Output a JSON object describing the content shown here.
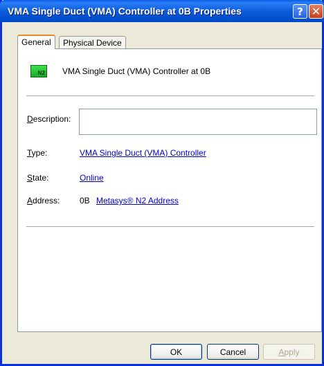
{
  "window": {
    "title": "VMA Single Duct (VMA) Controller at 0B Properties",
    "help_glyph": "?",
    "close_glyph": "✕"
  },
  "tabs": [
    {
      "label": "General",
      "active": true
    },
    {
      "label": "Physical Device",
      "active": false
    }
  ],
  "general": {
    "icon_label": "N2",
    "device_name": "VMA Single Duct (VMA) Controller at 0B",
    "description": {
      "label_access": "D",
      "label_rest": "escription:",
      "value": ""
    },
    "type": {
      "label_access": "T",
      "label_rest": "ype:",
      "value": "VMA Single Duct (VMA) Controller"
    },
    "state": {
      "label_access": "S",
      "label_rest": "tate:",
      "value": "Online"
    },
    "address": {
      "label_access": "A",
      "label_rest": "ddress:",
      "value": "0B",
      "link": "Metasys® N2 Address"
    }
  },
  "buttons": {
    "ok": "OK",
    "cancel": "Cancel",
    "apply_access": "A",
    "apply_rest": "pply"
  },
  "colors": {
    "titlebar": "#0a5ad8",
    "link": "#0000cc",
    "dialog_bg": "#ece9d8",
    "tab_active_accent": "#e68b2c"
  }
}
